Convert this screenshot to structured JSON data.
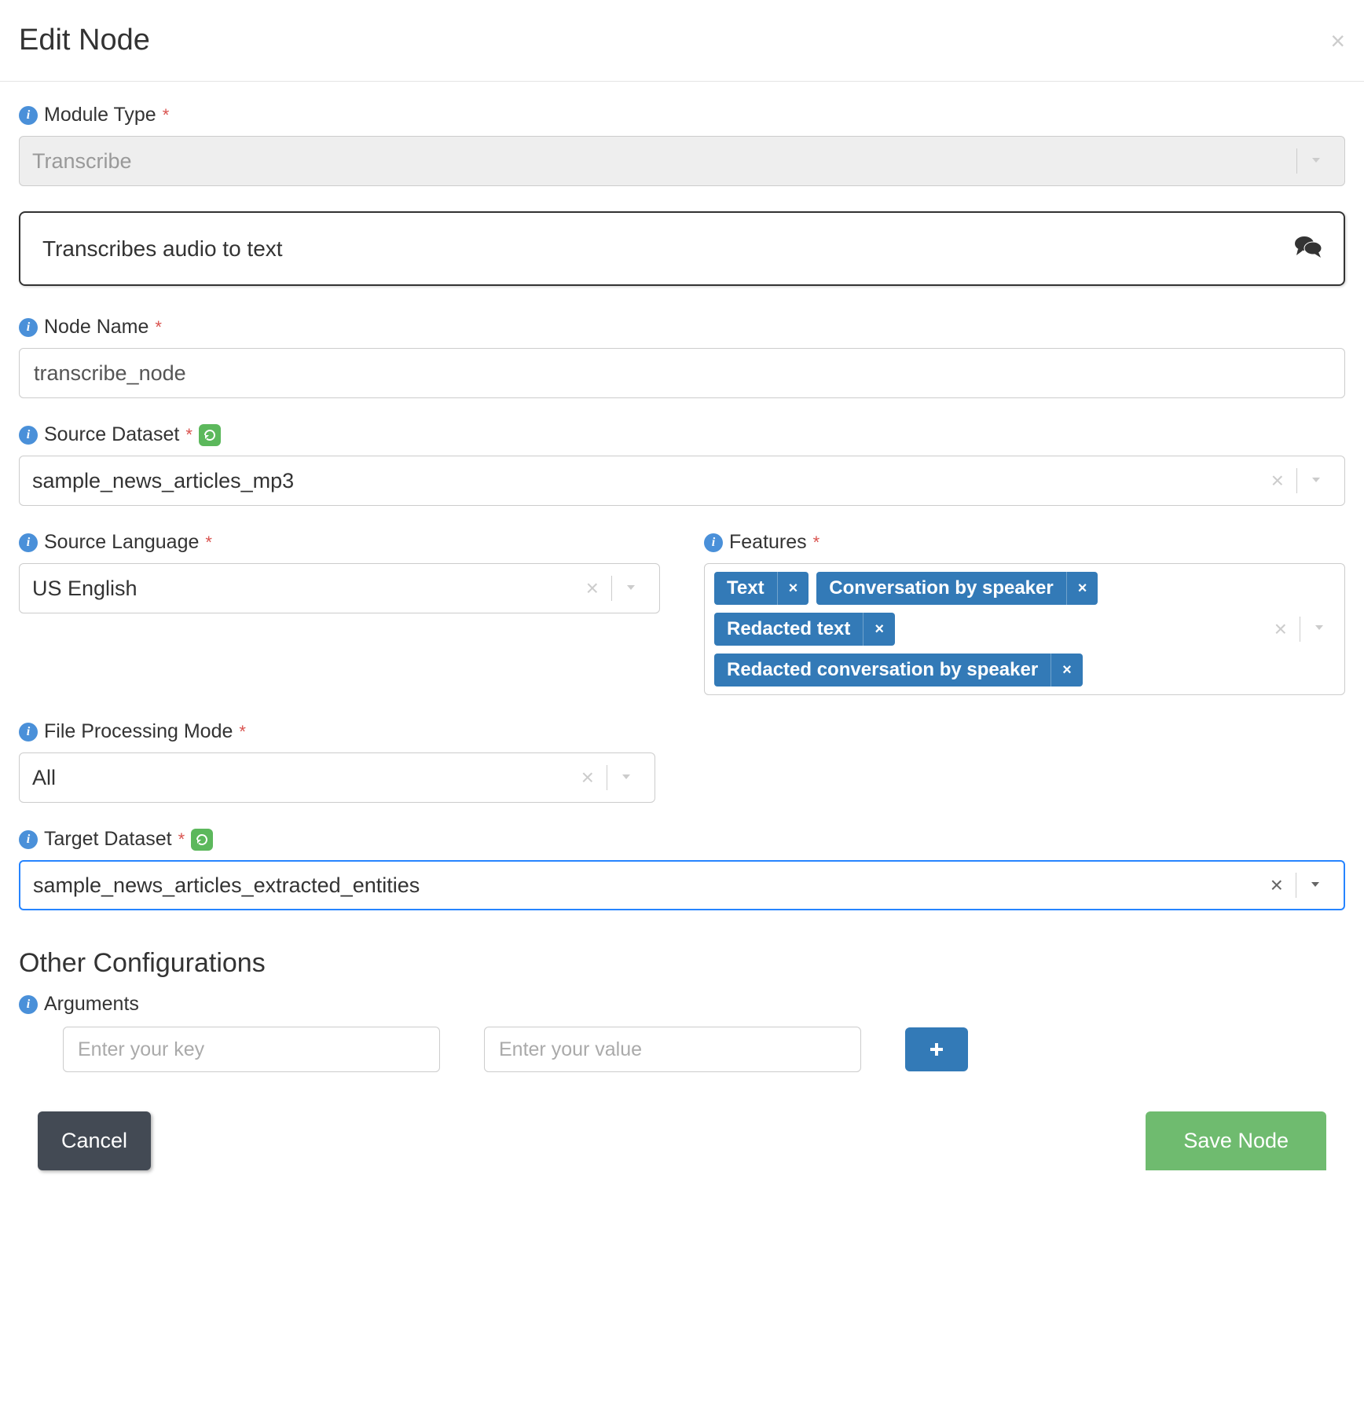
{
  "header": {
    "title": "Edit Node"
  },
  "moduleType": {
    "label": "Module Type",
    "value": "Transcribe",
    "description": "Transcribes audio to text"
  },
  "nodeName": {
    "label": "Node Name",
    "value": "transcribe_node"
  },
  "sourceDataset": {
    "label": "Source Dataset",
    "value": "sample_news_articles_mp3"
  },
  "sourceLanguage": {
    "label": "Source Language",
    "value": "US English"
  },
  "features": {
    "label": "Features",
    "tags": [
      "Text",
      "Conversation by speaker",
      "Redacted text",
      "Redacted conversation by speaker"
    ]
  },
  "fileProcessingMode": {
    "label": "File Processing Mode",
    "value": "All"
  },
  "targetDataset": {
    "label": "Target Dataset",
    "value": "sample_news_articles_extracted_entities"
  },
  "otherConfig": {
    "title": "Other Configurations",
    "argumentsLabel": "Arguments",
    "keyPlaceholder": "Enter your key",
    "valuePlaceholder": "Enter your value"
  },
  "footer": {
    "cancel": "Cancel",
    "save": "Save Node"
  }
}
